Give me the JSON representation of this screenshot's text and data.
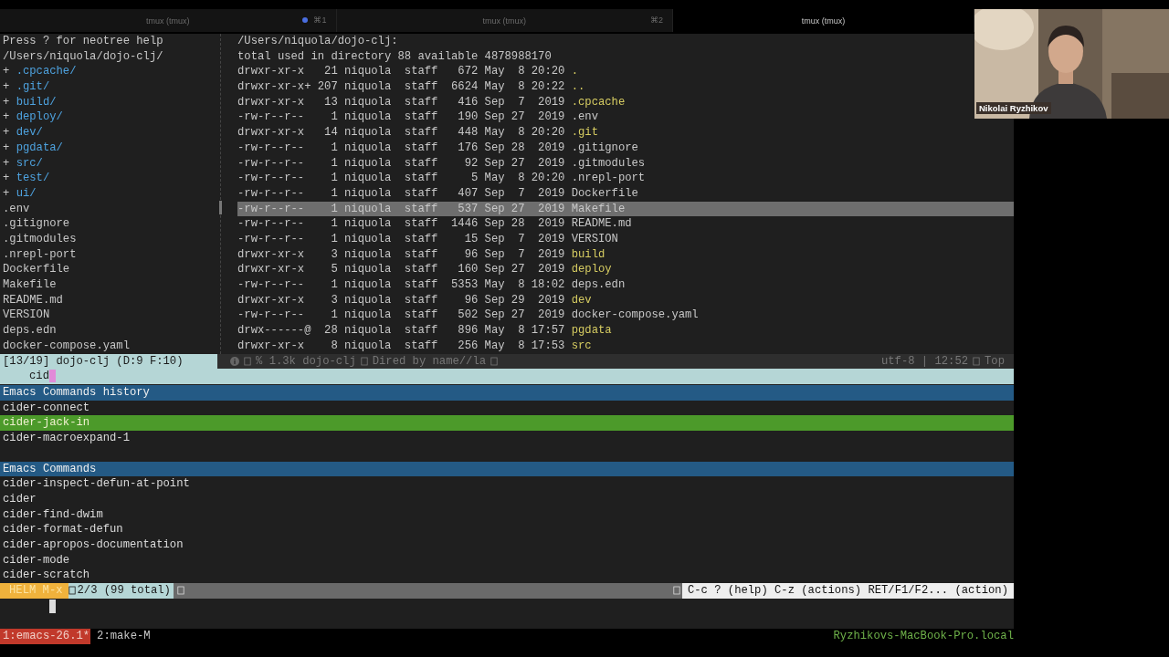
{
  "tabs": [
    {
      "title": "tmux (tmux)",
      "shortcut": "⌘1",
      "selected": false,
      "activity": true
    },
    {
      "title": "tmux (tmux)",
      "shortcut": "⌘2",
      "selected": false,
      "activity": false
    },
    {
      "title": "tmux (tmux)",
      "selected": true,
      "activity": false
    }
  ],
  "video": {
    "name": "Nikolai Ryzhikov"
  },
  "neotree": {
    "help": "Press ? for neotree help",
    "path": "/Users/niquola/dojo-clj/",
    "entries": [
      {
        "kind": "dir",
        "marker": "+",
        "name": ".cpcache/"
      },
      {
        "kind": "dir",
        "marker": "+",
        "name": ".git/"
      },
      {
        "kind": "dir",
        "marker": "+",
        "name": "build/"
      },
      {
        "kind": "dir",
        "marker": "+",
        "name": "deploy/"
      },
      {
        "kind": "dir",
        "marker": "+",
        "name": "dev/"
      },
      {
        "kind": "dir",
        "marker": "+",
        "name": "pgdata/"
      },
      {
        "kind": "dir",
        "marker": "+",
        "name": "src/"
      },
      {
        "kind": "dir",
        "marker": "+",
        "name": "test/"
      },
      {
        "kind": "dir",
        "marker": "+",
        "name": "ui/"
      },
      {
        "kind": "file",
        "name": ".env"
      },
      {
        "kind": "file",
        "name": ".gitignore"
      },
      {
        "kind": "file",
        "name": ".gitmodules"
      },
      {
        "kind": "file",
        "name": ".nrepl-port"
      },
      {
        "kind": "file",
        "name": "Dockerfile"
      },
      {
        "kind": "file",
        "name": "Makefile"
      },
      {
        "kind": "file",
        "name": "README.md"
      },
      {
        "kind": "file",
        "name": "VERSION"
      },
      {
        "kind": "file",
        "name": "deps.edn"
      },
      {
        "kind": "file",
        "name": "docker-compose.yaml"
      }
    ]
  },
  "dired": {
    "header": "/Users/niquola/dojo-clj:",
    "total": "total used in directory 88 available 4878988170",
    "rows": [
      {
        "info": "drwxr-xr-x   21 niquola  staff   672 May  8 20:20",
        "name": ".",
        "kind": "dir",
        "selected": false
      },
      {
        "info": "drwxr-xr-x+ 207 niquola  staff  6624 May  8 20:22",
        "name": "..",
        "kind": "dir",
        "selected": false
      },
      {
        "info": "drwxr-xr-x   13 niquola  staff   416 Sep  7  2019",
        "name": ".cpcache",
        "kind": "dir",
        "selected": false
      },
      {
        "info": "-rw-r--r--    1 niquola  staff   190 Sep 27  2019",
        "name": ".env",
        "kind": "file",
        "selected": false
      },
      {
        "info": "drwxr-xr-x   14 niquola  staff   448 May  8 20:20",
        "name": ".git",
        "kind": "dir",
        "selected": false
      },
      {
        "info": "-rw-r--r--    1 niquola  staff   176 Sep 28  2019",
        "name": ".gitignore",
        "kind": "file",
        "selected": false
      },
      {
        "info": "-rw-r--r--    1 niquola  staff    92 Sep 27  2019",
        "name": ".gitmodules",
        "kind": "file",
        "selected": false
      },
      {
        "info": "-rw-r--r--    1 niquola  staff     5 May  8 20:20",
        "name": ".nrepl-port",
        "kind": "file",
        "selected": false
      },
      {
        "info": "-rw-r--r--    1 niquola  staff   407 Sep  7  2019",
        "name": "Dockerfile",
        "kind": "file",
        "selected": false
      },
      {
        "info": "-rw-r--r--    1 niquola  staff   537 Sep 27  2019",
        "name": "Makefile",
        "kind": "file",
        "selected": true
      },
      {
        "info": "-rw-r--r--    1 niquola  staff  1446 Sep 28  2019",
        "name": "README.md",
        "kind": "file",
        "selected": false
      },
      {
        "info": "-rw-r--r--    1 niquola  staff    15 Sep  7  2019",
        "name": "VERSION",
        "kind": "file",
        "selected": false
      },
      {
        "info": "drwxr-xr-x    3 niquola  staff    96 Sep  7  2019",
        "name": "build",
        "kind": "dir",
        "selected": false
      },
      {
        "info": "drwxr-xr-x    5 niquola  staff   160 Sep 27  2019",
        "name": "deploy",
        "kind": "dir",
        "selected": false
      },
      {
        "info": "-rw-r--r--    1 niquola  staff  5353 May  8 18:02",
        "name": "deps.edn",
        "kind": "file",
        "selected": false
      },
      {
        "info": "drwxr-xr-x    3 niquola  staff    96 Sep 29  2019",
        "name": "dev",
        "kind": "dir",
        "selected": false
      },
      {
        "info": "-rw-r--r--    1 niquola  staff   502 Sep 27  2019",
        "name": "docker-compose.yaml",
        "kind": "file",
        "selected": false
      },
      {
        "info": "drwx------@  28 niquola  staff   896 May  8 17:57",
        "name": "pgdata",
        "kind": "dir",
        "selected": false
      },
      {
        "info": "drwxr-xr-x    8 niquola  staff   256 May  8 17:53",
        "name": "src",
        "kind": "dir",
        "selected": false
      }
    ]
  },
  "modeline": {
    "buffer_info": "[13/19] dojo-clj (D:9 F:10)",
    "size": "% 1.3k dojo-clj",
    "mode": "Dired by name//la",
    "encoding": "utf-8 | 12:52",
    "position": "Top"
  },
  "minibuffer": {
    "value": "cid"
  },
  "helm": {
    "sections": [
      {
        "title": "Emacs Commands history",
        "items": [
          {
            "text": "cider-connect",
            "selected": false
          },
          {
            "text": "cider-jack-in",
            "selected": true
          },
          {
            "text": "cider-macroexpand-1",
            "selected": false
          }
        ]
      },
      {
        "title": "Emacs Commands",
        "items": [
          {
            "text": "cider-inspect-defun-at-point",
            "selected": false
          },
          {
            "text": "cider",
            "selected": false
          },
          {
            "text": "cider-find-dwim",
            "selected": false
          },
          {
            "text": "cider-format-defun",
            "selected": false
          },
          {
            "text": "cider-apropos-documentation",
            "selected": false
          },
          {
            "text": "cider-mode",
            "selected": false
          },
          {
            "text": "cider-scratch",
            "selected": false
          }
        ]
      }
    ],
    "mode": "HELM M-x",
    "count": "2/3 (99 total)",
    "keys": "C-c ? (help) C-z (actions) RET/F1/F2... (action)"
  },
  "tmux": {
    "windows": [
      {
        "label": "1:emacs-26.1*",
        "selected": true
      },
      {
        "label": "2:make-M",
        "selected": false
      }
    ],
    "host": "Ryzhikovs-MacBook-Pro.local"
  }
}
